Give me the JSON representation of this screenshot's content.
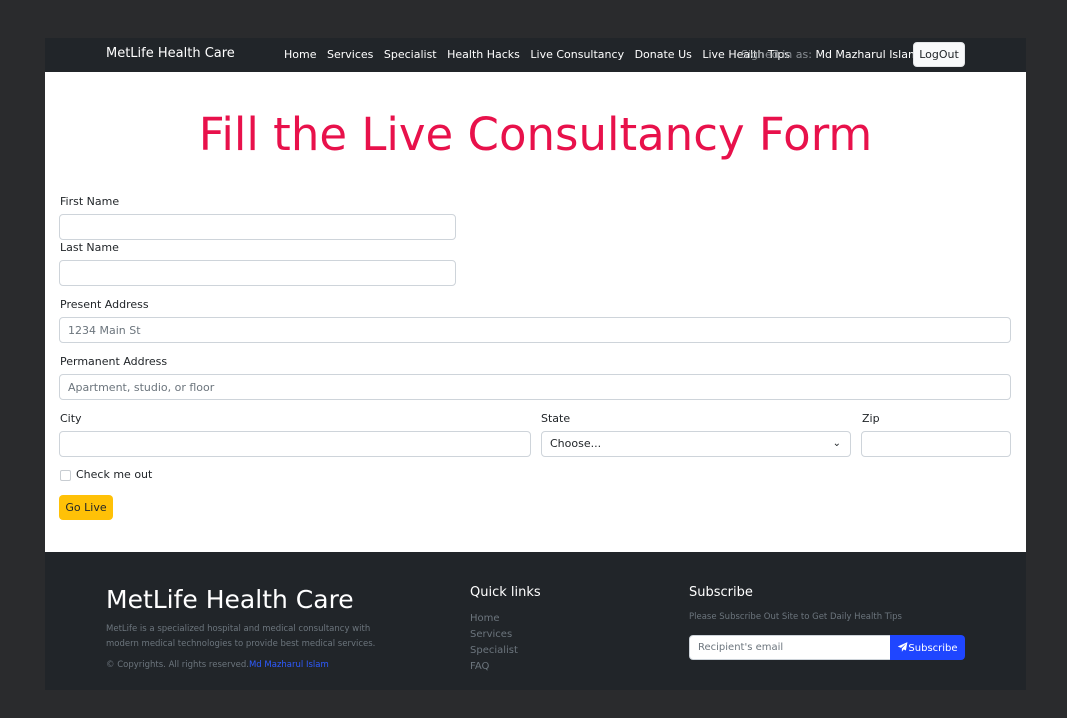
{
  "navbar": {
    "brand": "MetLife Health Care",
    "links": [
      "Home",
      "Services",
      "Specialist",
      "Health Hacks",
      "Live Consultancy",
      "Donate Us",
      "Live Health Tips"
    ],
    "signed_in_prefix": "Signed in as: ",
    "user_name": "Md Mazharul Islam",
    "logout_label": "LogOut"
  },
  "form": {
    "title": "Fill the Live Consultancy Form",
    "first_name": {
      "label": "First Name",
      "value": ""
    },
    "last_name": {
      "label": "Last Name",
      "value": ""
    },
    "present_address": {
      "label": "Present Address",
      "placeholder": "1234 Main St",
      "value": ""
    },
    "permanent_address": {
      "label": "Permanent Address",
      "placeholder": "Apartment, studio, or floor",
      "value": ""
    },
    "city": {
      "label": "City",
      "value": ""
    },
    "state": {
      "label": "State",
      "selected": "Choose..."
    },
    "zip": {
      "label": "Zip",
      "value": ""
    },
    "check_label": "Check me out",
    "checked": false,
    "submit_label": "Go Live"
  },
  "footer": {
    "brand": "MetLife Health Care",
    "description": "MetLife is a specialized hospital and medical consultancy with modern medical technologies to provide best medical services.",
    "copyright_prefix": "© Copyrights. All rights reserved.",
    "copyright_author": "Md Mazharul Islam",
    "quick_links_title": "Quick links",
    "quick_links": [
      "Home",
      "Services",
      "Specialist",
      "FAQ"
    ],
    "subscribe_title": "Subscribe",
    "subscribe_desc": "Please Subscribe Out Site to Get Daily Health Tips",
    "email_placeholder": "Recipient's email",
    "subscribe_button": "Subscribe"
  },
  "colors": {
    "title": "#e8114b",
    "navbar_bg": "#212529",
    "go_button": "#ffc107",
    "subscribe_button": "#1f46ff",
    "link": "#2e5bff"
  },
  "icons": {
    "state_select": "chevron-down-icon",
    "subscribe": "paper-plane-icon"
  }
}
